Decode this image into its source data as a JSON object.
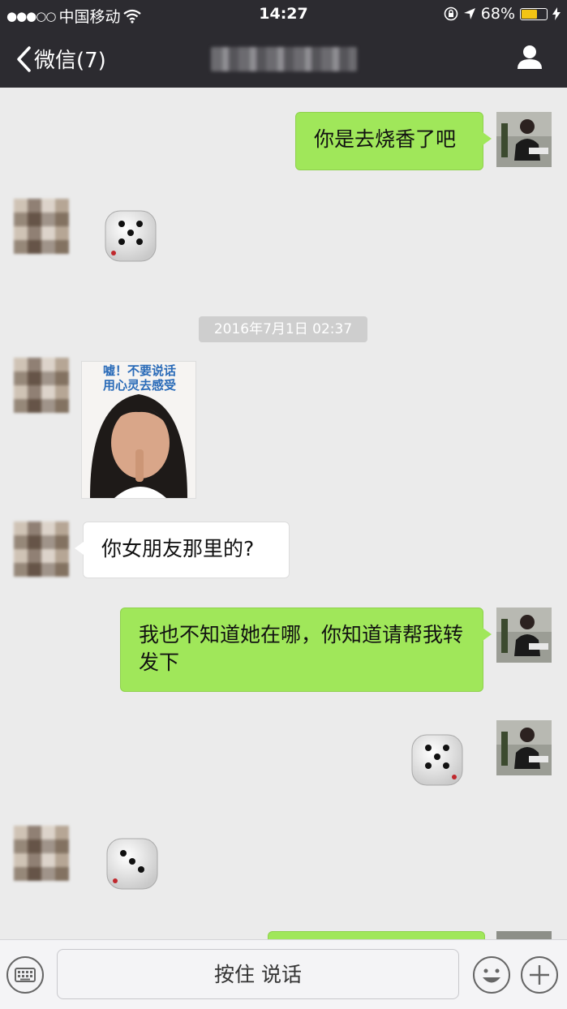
{
  "status": {
    "signal": "●●●○○",
    "carrier": "中国移动",
    "time": "14:27",
    "battery": "68%",
    "battery_level": 0.68,
    "battery_color": "#f3c414"
  },
  "nav": {
    "back_label": "微信(7)",
    "profile_icon": "person-icon"
  },
  "timestamp": "2016年7月1日 02:37",
  "messages": [
    {
      "side": "me",
      "type": "text",
      "text": "你是去烧香了吧"
    },
    {
      "side": "other",
      "type": "dice",
      "face": 5
    },
    {
      "side": "other",
      "type": "sticker",
      "text": "嘘！不要说话\n用心灵去感受"
    },
    {
      "side": "other",
      "type": "text",
      "text": "你女朋友那里的?"
    },
    {
      "side": "me",
      "type": "text",
      "text": "我也不知道她在哪，你知道请帮我转发下"
    },
    {
      "side": "me",
      "type": "dice",
      "face": 5
    },
    {
      "side": "other",
      "type": "dice",
      "face": 3
    }
  ],
  "input": {
    "hold_to_talk": "按住 说话",
    "keyboard_icon": "keyboard-icon",
    "emoji_icon": "emoji-icon",
    "plus_icon": "plus-icon"
  },
  "colors": {
    "nav_bg": "#2c2b30",
    "chat_bg": "#ebebeb",
    "green_bubble": "#a0e75a",
    "white_bubble": "#ffffff"
  }
}
